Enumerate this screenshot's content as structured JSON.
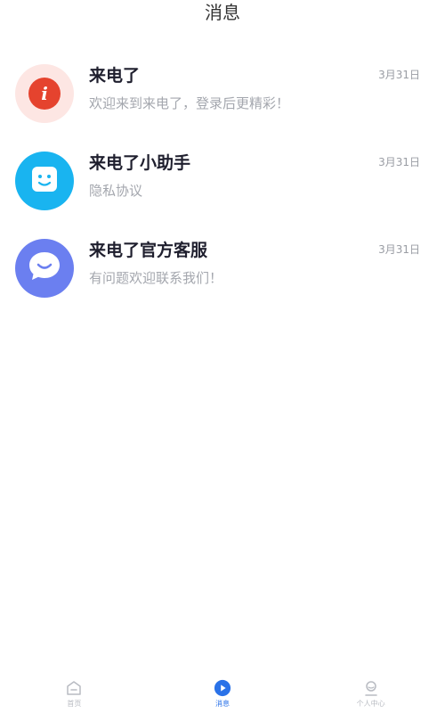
{
  "header": {
    "title": "消息"
  },
  "messages": [
    {
      "name": "来电了",
      "preview": "欢迎来到来电了，登录后更精彩！",
      "date": "3月31日",
      "icon": "info-icon",
      "color": "#e5432e"
    },
    {
      "name": "来电了小助手",
      "preview": "隐私协议",
      "date": "3月31日",
      "icon": "robot-face-icon",
      "color": "#19b4f0"
    },
    {
      "name": "来电了官方客服",
      "preview": "有问题欢迎联系我们！",
      "date": "3月31日",
      "icon": "chat-bubble-icon",
      "color": "#6b7ff0"
    }
  ],
  "tabbar": {
    "tabs": [
      {
        "label": "首页",
        "icon": "home-icon",
        "active": false
      },
      {
        "label": "消息",
        "icon": "message-play-icon",
        "active": true
      },
      {
        "label": "个人中心",
        "icon": "profile-icon",
        "active": false
      }
    ],
    "active_color": "#2a72e8",
    "inactive_color": "#b8bbc2"
  }
}
